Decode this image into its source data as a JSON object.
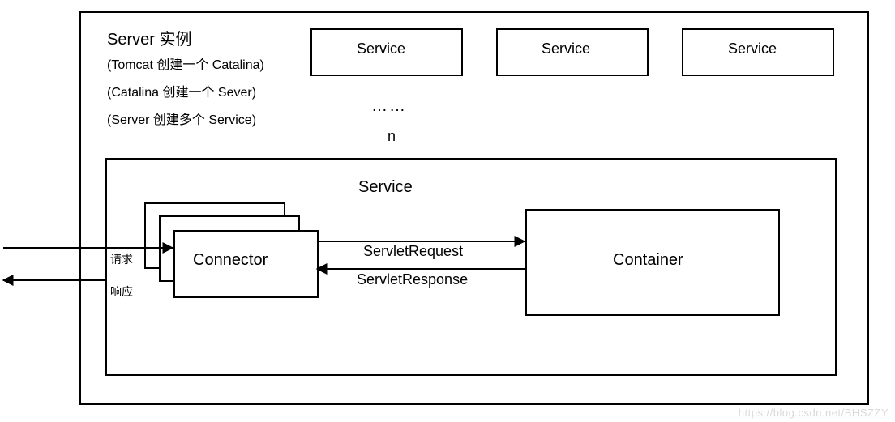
{
  "server": {
    "title": "Server 实例",
    "note1": "(Tomcat 创建一个 Catalina)",
    "note2": "(Catalina 创建一个 Sever)",
    "note3": "(Server 创建多个 Service)"
  },
  "top_services": {
    "a": "Service",
    "b": "Service",
    "c": "Service",
    "ellipsis": "……",
    "n": "n"
  },
  "service_box": {
    "title": "Service",
    "connector": "Connector",
    "container": "Container",
    "servlet_request": "ServletRequest",
    "servlet_response": "ServletResponse"
  },
  "io": {
    "request": "请求",
    "response": "响应"
  },
  "watermark": "https://blog.csdn.net/BHSZZY"
}
